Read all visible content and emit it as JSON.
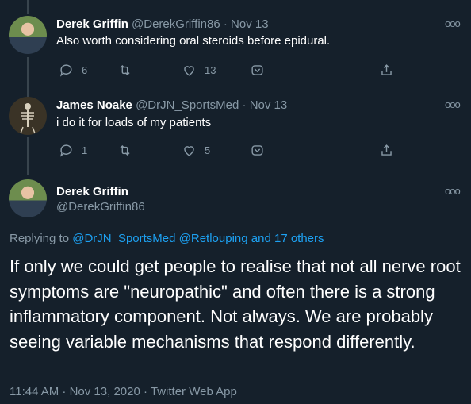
{
  "tweets": [
    {
      "name": "Derek Griffin",
      "handle": "@DerekGriffin86",
      "date": "Nov 13",
      "text": "Also worth considering oral steroids before epidural.",
      "replies": "6",
      "retweets": "",
      "likes": "13"
    },
    {
      "name": "James Noake",
      "handle": "@DrJN_SportsMed",
      "date": "Nov 13",
      "text": "i do it for loads of my patients",
      "replies": "1",
      "retweets": "",
      "likes": "5"
    }
  ],
  "main_tweet": {
    "name": "Derek Griffin",
    "handle": "@DerekGriffin86",
    "replying_prefix": "Replying to",
    "replying_to_1": "@DrJN_SportsMed",
    "replying_to_2": "@Retlouping",
    "replying_others": "and 17 others",
    "text": "If only we could get people to realise that not all nerve root symptoms are \"neuropathic\" and often there is a strong inflammatory component. Not always. We are probably seeing variable mechanisms that respond differently.",
    "timestamp": "11:44 AM · Nov 13, 2020 · Twitter Web App"
  },
  "more_label": "ooo",
  "sep": "·"
}
